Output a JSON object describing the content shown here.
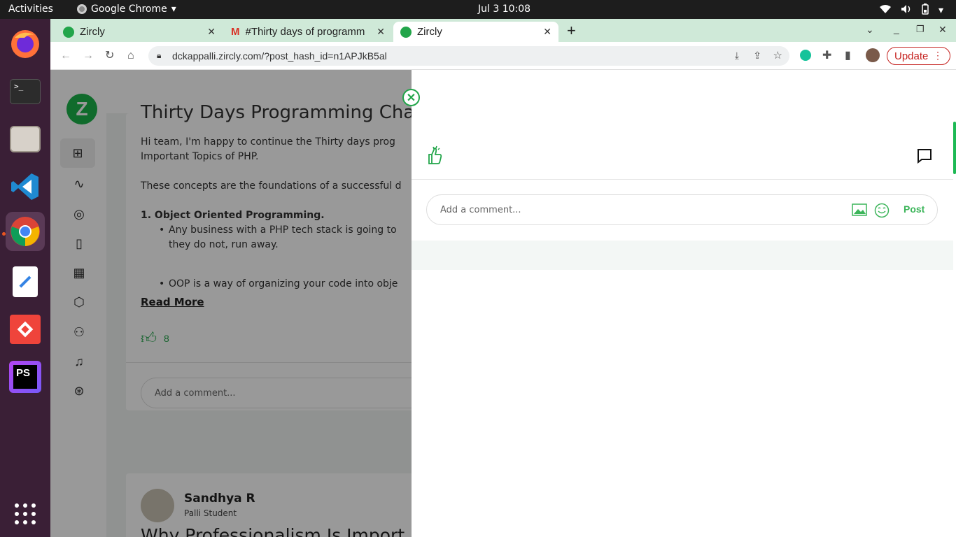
{
  "system": {
    "activities": "Activities",
    "app_name": "Google Chrome",
    "clock": "Jul 3  10:08"
  },
  "dock": {
    "items": [
      "firefox-icon",
      "terminal-icon",
      "files-icon",
      "vscode-icon",
      "chrome-icon",
      "text-editor-icon",
      "anydesk-icon",
      "phpstorm-icon",
      "app-grid-icon"
    ]
  },
  "browser": {
    "tabs": [
      {
        "label": "Zircly"
      },
      {
        "label": "#Thirty days of programm"
      },
      {
        "label": "Zircly"
      }
    ],
    "url": "dckappalli.zircly.com/?post_hash_id=n1APJkB5al",
    "update_label": "Update"
  },
  "feed": {
    "post1": {
      "title_partial": "Thirty Days Programming Chal",
      "para1": "Hi team, I'm happy to continue the Thirty days prog",
      "para1b": "Important Topics of PHP.",
      "para2": "These concepts are the foundations of a successful d",
      "heading": "1. Object Oriented Programming.",
      "bullet1": "Any business with a PHP tech stack is going to",
      "bullet1b": "they do not, run away.",
      "bullet2": "OOP is a way of organizing your code into obje",
      "read_more": "Read More",
      "likes": "8",
      "comment_placeholder": "Add a comment..."
    },
    "post2": {
      "author": "Sandhya R",
      "role": "Palli Student",
      "title_partial": "Why Professionalism Is Import"
    }
  },
  "drawer": {
    "comment_placeholder": "Add a comment...",
    "post_label": "Post"
  },
  "colors": {
    "accent": "#22a54a",
    "tab_bar": "#cfe9d8",
    "dock": "#3a1f36"
  }
}
